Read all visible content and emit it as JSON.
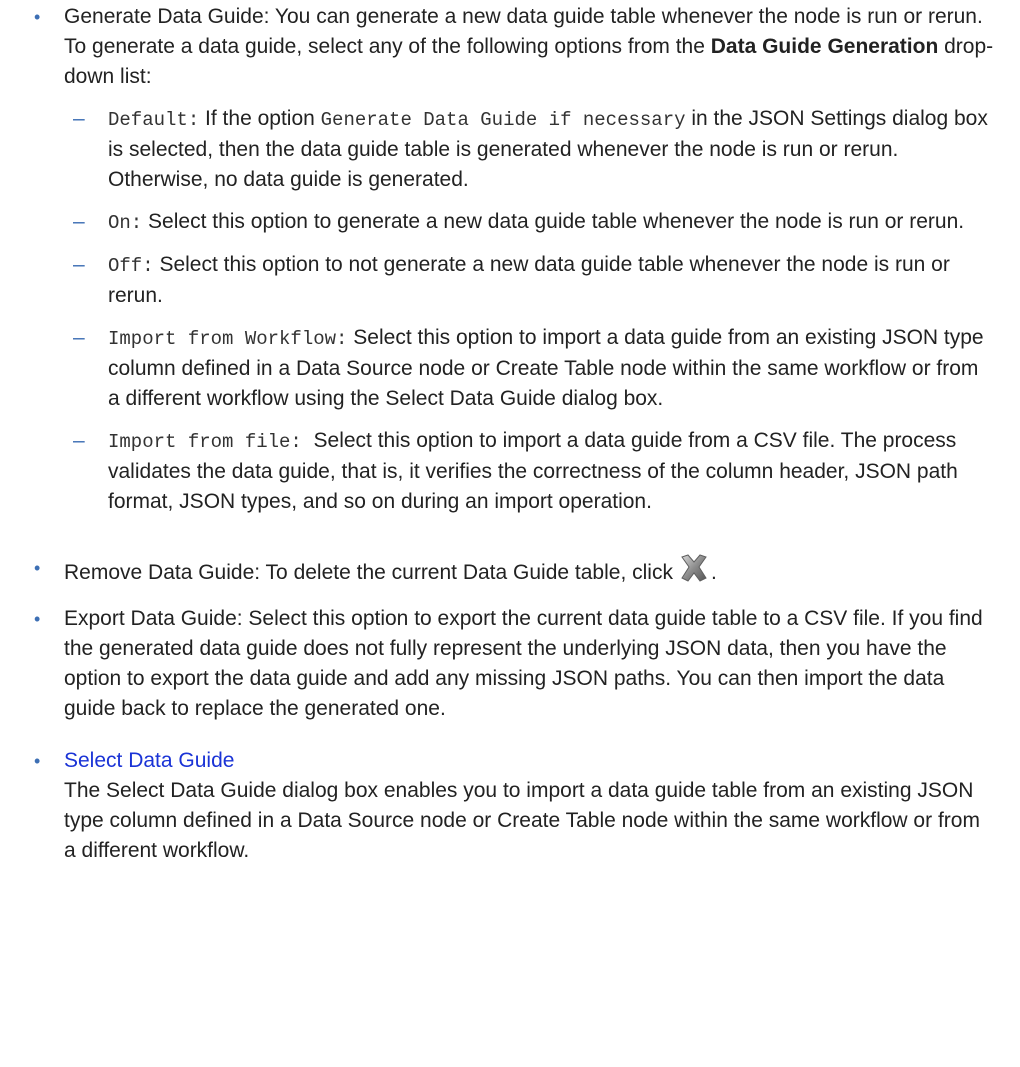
{
  "bullets": {
    "generate": {
      "lead": "Generate Data Guide:",
      "text_before_bold": " You can generate a new data guide table whenever the node is run or rerun. To generate a data guide, select any of the following options from the ",
      "bold": "Data Guide Generation",
      "text_after_bold": " drop-down list:",
      "options": [
        {
          "code": "Default:",
          "pre": " If the option ",
          "code2": "Generate Data Guide if necessary",
          "post": " in the JSON Settings dialog box is selected, then the data guide table is generated whenever the node is run or rerun. Otherwise, no data guide is generated."
        },
        {
          "code": "On:",
          "text": " Select this option to generate a new data guide table whenever the node is run or rerun."
        },
        {
          "code": "Off:",
          "text": " Select this option to not generate a new data guide table whenever the node is run or rerun."
        },
        {
          "code": "Import from Workflow:",
          "text": " Select this option to import a data guide from an existing JSON type column defined in a Data Source node or Create Table node within the same workflow or from a different workflow using the Select Data Guide dialog box."
        },
        {
          "code": "Import from file:",
          "text": "  Select this option to import a data guide from a CSV file. The process validates the data guide, that is, it verifies the correctness of the column header, JSON path format, JSON types, and so on during an import operation."
        }
      ]
    },
    "remove": {
      "text": "Remove Data Guide: To delete the current Data Guide table, click",
      "icon": "delete-x-icon",
      "after": "."
    },
    "export": {
      "text": "Export Data Guide: Select this option to export the current data guide table to a CSV file. If you find the generated data guide does not fully represent the underlying JSON data, then you have the option to export the data guide and add any missing JSON paths. You can then import the data guide back to replace the generated one."
    },
    "select": {
      "link": "Select Data Guide",
      "desc": "The Select Data Guide dialog box enables you to import a data guide table from an existing JSON type column defined in a Data Source node or Create Table node within the same workflow or from a different workflow."
    }
  },
  "colors": {
    "text": "#222222",
    "bullet": "#3d6fb4",
    "link": "#1a33d6"
  }
}
